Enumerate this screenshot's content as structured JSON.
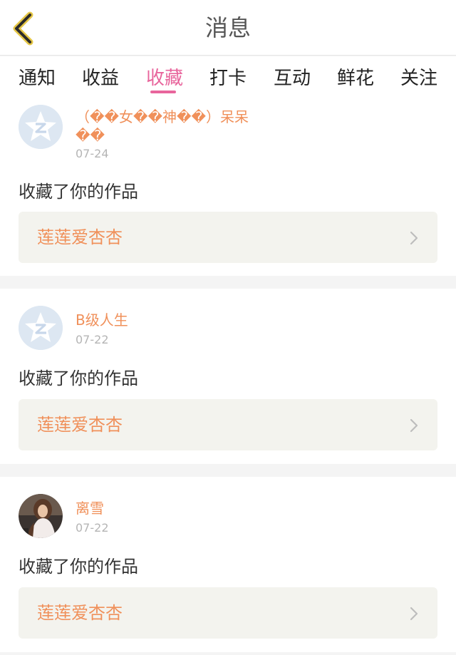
{
  "header": {
    "title": "消息",
    "back_icon": "chevron-left-icon",
    "back_color": "#e5c645"
  },
  "tabs": [
    {
      "label": "通知"
    },
    {
      "label": "收益"
    },
    {
      "label": "收藏"
    },
    {
      "label": "打卡"
    },
    {
      "label": "互动"
    },
    {
      "label": "鲜花"
    },
    {
      "label": "关注"
    }
  ],
  "active_tab": "收藏",
  "colors": {
    "accent": "#e8659c",
    "username": "#f0905a",
    "work_title": "#f0905a",
    "date": "#b5b5b5"
  },
  "notifications": [
    {
      "username_line1": "（��女��神��）呆呆",
      "username_line2": "��",
      "date": "07-24",
      "action": "收藏了你的作品",
      "work_title": "莲莲爱杏杏",
      "avatar": "default-star-avatar"
    },
    {
      "username_line1": "B级人生",
      "username_line2": "",
      "date": "07-22",
      "action": "收藏了你的作品",
      "work_title": "莲莲爱杏杏",
      "avatar": "default-star-avatar"
    },
    {
      "username_line1": "离雪",
      "username_line2": "",
      "date": "07-22",
      "action": "收藏了你的作品",
      "work_title": "莲莲爱杏杏",
      "avatar": "photo-avatar"
    }
  ]
}
